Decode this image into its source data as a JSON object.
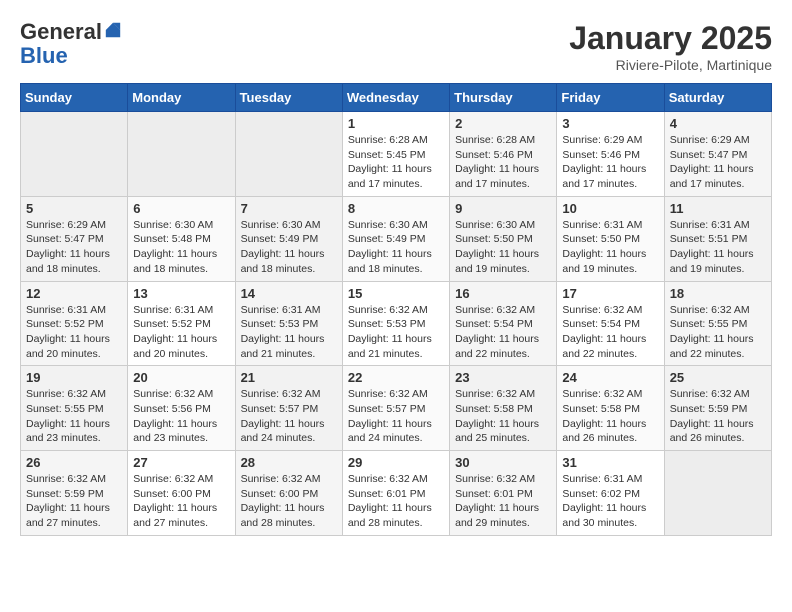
{
  "header": {
    "logo_general": "General",
    "logo_blue": "Blue",
    "month_title": "January 2025",
    "subtitle": "Riviere-Pilote, Martinique"
  },
  "weekdays": [
    "Sunday",
    "Monday",
    "Tuesday",
    "Wednesday",
    "Thursday",
    "Friday",
    "Saturday"
  ],
  "weeks": [
    [
      {
        "day": "",
        "info": ""
      },
      {
        "day": "",
        "info": ""
      },
      {
        "day": "",
        "info": ""
      },
      {
        "day": "1",
        "info": "Sunrise: 6:28 AM\nSunset: 5:45 PM\nDaylight: 11 hours\nand 17 minutes."
      },
      {
        "day": "2",
        "info": "Sunrise: 6:28 AM\nSunset: 5:46 PM\nDaylight: 11 hours\nand 17 minutes."
      },
      {
        "day": "3",
        "info": "Sunrise: 6:29 AM\nSunset: 5:46 PM\nDaylight: 11 hours\nand 17 minutes."
      },
      {
        "day": "4",
        "info": "Sunrise: 6:29 AM\nSunset: 5:47 PM\nDaylight: 11 hours\nand 17 minutes."
      }
    ],
    [
      {
        "day": "5",
        "info": "Sunrise: 6:29 AM\nSunset: 5:47 PM\nDaylight: 11 hours\nand 18 minutes."
      },
      {
        "day": "6",
        "info": "Sunrise: 6:30 AM\nSunset: 5:48 PM\nDaylight: 11 hours\nand 18 minutes."
      },
      {
        "day": "7",
        "info": "Sunrise: 6:30 AM\nSunset: 5:49 PM\nDaylight: 11 hours\nand 18 minutes."
      },
      {
        "day": "8",
        "info": "Sunrise: 6:30 AM\nSunset: 5:49 PM\nDaylight: 11 hours\nand 18 minutes."
      },
      {
        "day": "9",
        "info": "Sunrise: 6:30 AM\nSunset: 5:50 PM\nDaylight: 11 hours\nand 19 minutes."
      },
      {
        "day": "10",
        "info": "Sunrise: 6:31 AM\nSunset: 5:50 PM\nDaylight: 11 hours\nand 19 minutes."
      },
      {
        "day": "11",
        "info": "Sunrise: 6:31 AM\nSunset: 5:51 PM\nDaylight: 11 hours\nand 19 minutes."
      }
    ],
    [
      {
        "day": "12",
        "info": "Sunrise: 6:31 AM\nSunset: 5:52 PM\nDaylight: 11 hours\nand 20 minutes."
      },
      {
        "day": "13",
        "info": "Sunrise: 6:31 AM\nSunset: 5:52 PM\nDaylight: 11 hours\nand 20 minutes."
      },
      {
        "day": "14",
        "info": "Sunrise: 6:31 AM\nSunset: 5:53 PM\nDaylight: 11 hours\nand 21 minutes."
      },
      {
        "day": "15",
        "info": "Sunrise: 6:32 AM\nSunset: 5:53 PM\nDaylight: 11 hours\nand 21 minutes."
      },
      {
        "day": "16",
        "info": "Sunrise: 6:32 AM\nSunset: 5:54 PM\nDaylight: 11 hours\nand 22 minutes."
      },
      {
        "day": "17",
        "info": "Sunrise: 6:32 AM\nSunset: 5:54 PM\nDaylight: 11 hours\nand 22 minutes."
      },
      {
        "day": "18",
        "info": "Sunrise: 6:32 AM\nSunset: 5:55 PM\nDaylight: 11 hours\nand 22 minutes."
      }
    ],
    [
      {
        "day": "19",
        "info": "Sunrise: 6:32 AM\nSunset: 5:55 PM\nDaylight: 11 hours\nand 23 minutes."
      },
      {
        "day": "20",
        "info": "Sunrise: 6:32 AM\nSunset: 5:56 PM\nDaylight: 11 hours\nand 23 minutes."
      },
      {
        "day": "21",
        "info": "Sunrise: 6:32 AM\nSunset: 5:57 PM\nDaylight: 11 hours\nand 24 minutes."
      },
      {
        "day": "22",
        "info": "Sunrise: 6:32 AM\nSunset: 5:57 PM\nDaylight: 11 hours\nand 24 minutes."
      },
      {
        "day": "23",
        "info": "Sunrise: 6:32 AM\nSunset: 5:58 PM\nDaylight: 11 hours\nand 25 minutes."
      },
      {
        "day": "24",
        "info": "Sunrise: 6:32 AM\nSunset: 5:58 PM\nDaylight: 11 hours\nand 26 minutes."
      },
      {
        "day": "25",
        "info": "Sunrise: 6:32 AM\nSunset: 5:59 PM\nDaylight: 11 hours\nand 26 minutes."
      }
    ],
    [
      {
        "day": "26",
        "info": "Sunrise: 6:32 AM\nSunset: 5:59 PM\nDaylight: 11 hours\nand 27 minutes."
      },
      {
        "day": "27",
        "info": "Sunrise: 6:32 AM\nSunset: 6:00 PM\nDaylight: 11 hours\nand 27 minutes."
      },
      {
        "day": "28",
        "info": "Sunrise: 6:32 AM\nSunset: 6:00 PM\nDaylight: 11 hours\nand 28 minutes."
      },
      {
        "day": "29",
        "info": "Sunrise: 6:32 AM\nSunset: 6:01 PM\nDaylight: 11 hours\nand 28 minutes."
      },
      {
        "day": "30",
        "info": "Sunrise: 6:32 AM\nSunset: 6:01 PM\nDaylight: 11 hours\nand 29 minutes."
      },
      {
        "day": "31",
        "info": "Sunrise: 6:31 AM\nSunset: 6:02 PM\nDaylight: 11 hours\nand 30 minutes."
      },
      {
        "day": "",
        "info": ""
      }
    ]
  ]
}
